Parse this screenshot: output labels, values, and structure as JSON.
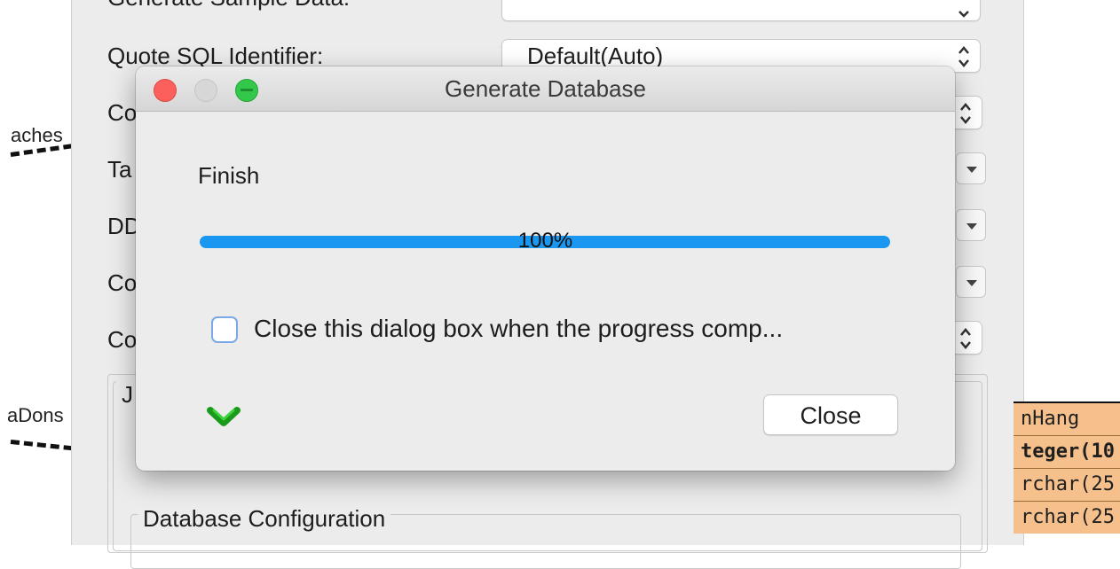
{
  "background": {
    "settings": {
      "row_generate_sample_label": "Generate Sample Data:",
      "row_quote_label": "Quote SQL Identifier:",
      "row_quote_value": "Default(Auto)",
      "row_co1_label": "Co",
      "row_ta_label": "Ta",
      "row_dd_label": "DD",
      "row_co2_label": "Co",
      "row_co3_label": "Co",
      "group_j_label": "J",
      "group_db_config_label": "Database Configuration"
    },
    "er_labels": {
      "left_top": "aches",
      "left_bottom": "aDons"
    },
    "er_table": {
      "title": "nHang",
      "rows": [
        "teger(10",
        "rchar(25",
        "rchar(25"
      ]
    }
  },
  "dialog": {
    "title": "Generate Database",
    "status": "Finish",
    "progress": {
      "value": 1.0,
      "label": "100%"
    },
    "checkbox": {
      "label": "Close this dialog box when the progress comp...",
      "checked": false
    },
    "close_button": "Close"
  }
}
